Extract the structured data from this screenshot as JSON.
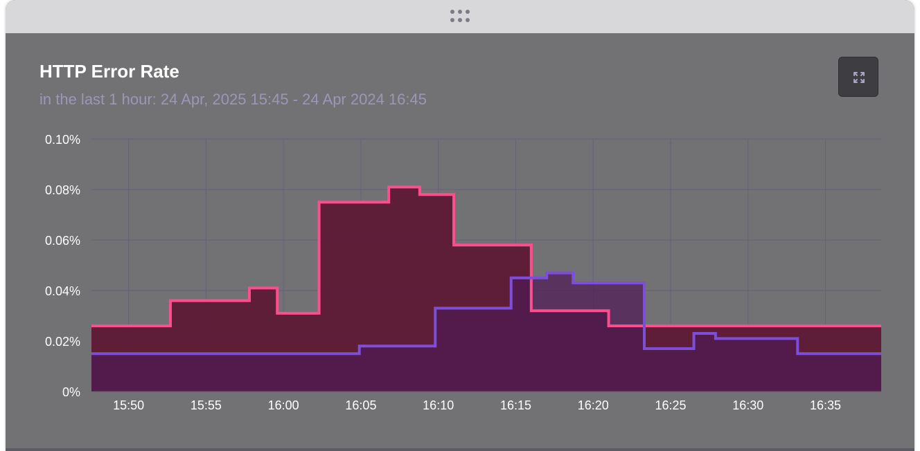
{
  "panel": {
    "title": "HTTP Error Rate",
    "subtitle": "in the last 1 hour: 24 Apr, 2025 15:45 - 24 Apr 2024 16:45",
    "drag_handle_icon": "drag-handle-icon",
    "expand_icon": "expand-icon"
  },
  "colors": {
    "panel_bg": "#727173",
    "pink_series": "#ff4d8d",
    "pink_fill": "#5c1733",
    "purple_series": "#7c4fd6",
    "purple_fill": "#4f1a55",
    "grid": "#67607f",
    "subtitle": "#9c96b8"
  },
  "chart_data": {
    "type": "area",
    "step": true,
    "x_ticks": [
      "15:50",
      "15:55",
      "16:00",
      "16:05",
      "16:10",
      "16:15",
      "16:20",
      "16:25",
      "16:30",
      "16:35"
    ],
    "y_ticks": [
      "0%",
      "0.02%",
      "0.04%",
      "0.06%",
      "0.08%",
      "0.10%"
    ],
    "ylim": [
      0,
      0.1
    ],
    "xlim_minutes": [
      "15:47.6",
      "16:38.6"
    ],
    "grid": true,
    "series": [
      {
        "color": "#ff4d8d",
        "fill": "#5c1733",
        "points": [
          [
            "15:47.6",
            0.026
          ],
          [
            "15:52.7",
            0.036
          ],
          [
            "15:57.8",
            0.041
          ],
          [
            "15:59.6",
            0.031
          ],
          [
            "16:02.3",
            0.075
          ],
          [
            "16:06.8",
            0.081
          ],
          [
            "16:08.8",
            0.078
          ],
          [
            "16:11.0",
            0.058
          ],
          [
            "16:16.0",
            0.032
          ],
          [
            "16:21.0",
            0.026
          ]
        ],
        "end": "16:38.6"
      },
      {
        "color": "#7c4fd6",
        "fill": "#4f1a55",
        "points": [
          [
            "15:47.6",
            0.015
          ],
          [
            "16:04.9",
            0.018
          ],
          [
            "16:09.8",
            0.033
          ],
          [
            "16:14.7",
            0.045
          ],
          [
            "16:17.0",
            0.047
          ],
          [
            "16:18.7",
            0.043
          ],
          [
            "16:23.3",
            0.017
          ],
          [
            "16:26.5",
            0.023
          ],
          [
            "16:27.9",
            0.021
          ],
          [
            "16:33.2",
            0.015
          ]
        ],
        "end": "16:38.6"
      }
    ]
  }
}
